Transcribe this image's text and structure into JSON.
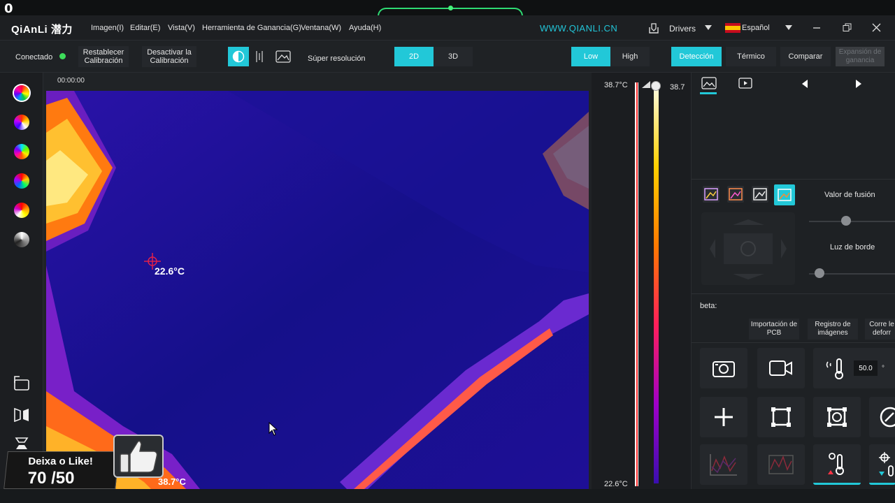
{
  "overlay": {
    "corner_number": "0",
    "like_title": "Deixa o Like!",
    "like_count": "70 /50"
  },
  "menubar": {
    "logo": "QiAnLi 潜力",
    "items": [
      "Imagen(I)",
      "Editar(E)",
      "Vista(V)",
      "Herramienta de Ganancia(G)",
      "Ventana(W)",
      "Ayuda(H)"
    ],
    "website": "WWW.QIANLI.CN",
    "drivers": "Drivers",
    "language": "Español"
  },
  "toolbar": {
    "status_label": "Conectado",
    "status_color": "#3ddc5a",
    "reset_calibration": "Restablecer Calibración",
    "disable_calibration": "Desactivar la Calibración",
    "super_resolution": "Súper resolución",
    "mode_2d": "2D",
    "mode_3d": "3D",
    "gain_low": "Low",
    "gain_high": "High",
    "detection": "Detección",
    "thermal": "Térmico",
    "compare": "Comparar",
    "gain_expansion": "Expansión de ganancia",
    "accent_color": "#22c8d8"
  },
  "viewer": {
    "timecode": "00:00:00",
    "spot_temp": "22.6°C",
    "max_temp_label": "38.7°C"
  },
  "scale": {
    "max": "38.7°C",
    "max_right": "38.7",
    "min": "22.6°C"
  },
  "rightpanel": {
    "fusion_value": "Valor de fusión",
    "edge_light": "Luz de borde",
    "beta_label": "beta:",
    "pcb_import": "Importación de PCB",
    "image_registration": "Registro de imágenes",
    "correction": "Corre le deforr",
    "temp_value": "50.0",
    "temp_unit": "°"
  },
  "icons": {
    "left_palettes": [
      "palette-rainbow-icon",
      "palette-iron-icon",
      "palette-rainbow2-icon",
      "palette-lava-icon",
      "palette-medical-icon",
      "palette-grayscale-icon"
    ]
  }
}
